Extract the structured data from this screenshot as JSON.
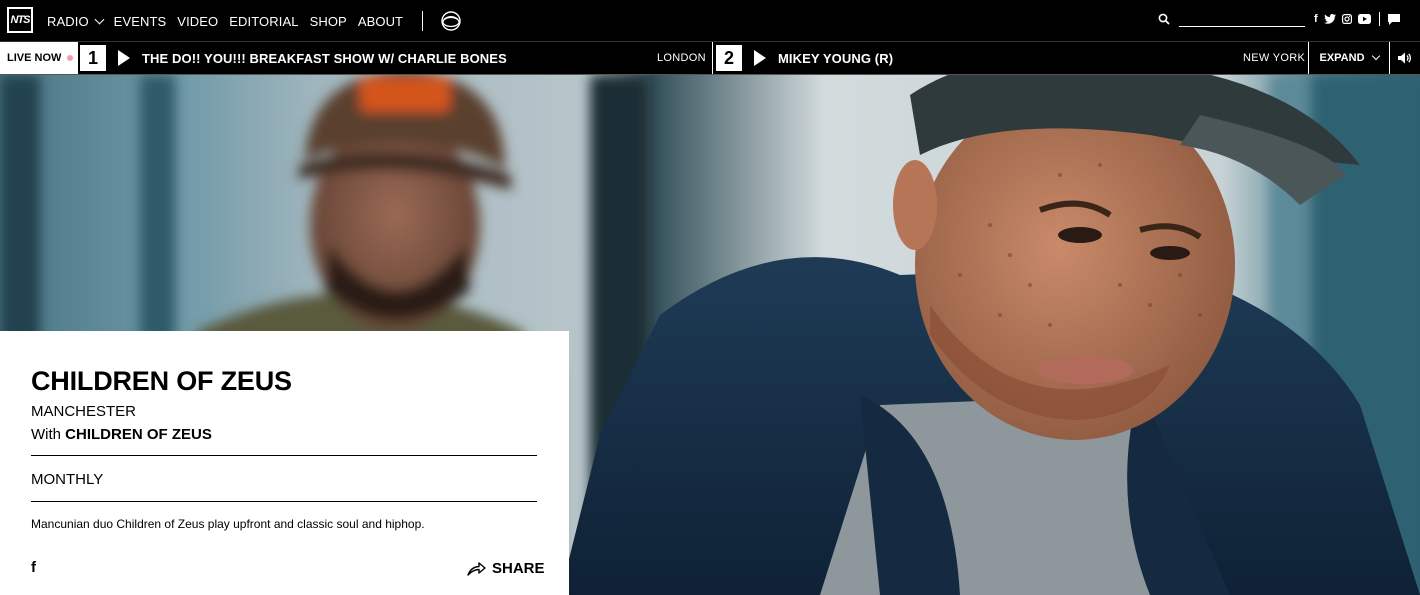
{
  "brand": {
    "logo_text": "NTS"
  },
  "nav": {
    "items": [
      {
        "label": "RADIO",
        "has_dropdown": true
      },
      {
        "label": "EVENTS"
      },
      {
        "label": "VIDEO"
      },
      {
        "label": "EDITORIAL"
      },
      {
        "label": "SHOP"
      },
      {
        "label": "ABOUT"
      }
    ],
    "extra_icon": "ring-logo-icon"
  },
  "search": {
    "icon": "search-icon",
    "placeholder": "",
    "value": ""
  },
  "social": {
    "icons": [
      "facebook-icon",
      "twitter-icon",
      "instagram-icon",
      "youtube-icon",
      "chat-icon"
    ],
    "glyphs": {
      "facebook": "f",
      "twitter": "t"
    }
  },
  "live": {
    "label": "LIVE NOW",
    "channels": [
      {
        "number": "1",
        "title": "THE DO!! YOU!!! BREAKFAST SHOW W/ CHARLIE BONES",
        "location": "LONDON"
      },
      {
        "number": "2",
        "title": "MIKEY YOUNG (R)",
        "location": "NEW YORK"
      }
    ],
    "expand_label": "EXPAND",
    "live_dot_color": "#f2a0a8"
  },
  "show": {
    "title": "CHILDREN OF ZEUS",
    "location": "MANCHESTER",
    "with_prefix": "With",
    "host": "CHILDREN OF ZEUS",
    "frequency": "MONTHLY",
    "description": "Mancunian duo Children of Zeus play upfront and classic soul and hiphop.",
    "facebook_glyph": "f",
    "share_label": "SHARE"
  },
  "colors": {
    "nav_bg": "#000000",
    "card_bg": "#ffffff",
    "hero_tint": "#4f7b8a"
  }
}
